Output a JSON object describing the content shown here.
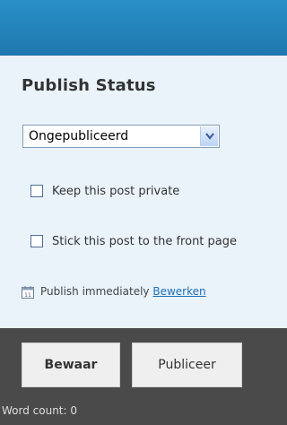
{
  "panel": {
    "title": "Publish Status",
    "status_select": {
      "selected": "Ongepubliceerd"
    },
    "checkbox_private": {
      "label": "Keep this post private",
      "checked": false
    },
    "checkbox_sticky": {
      "label": "Stick this post to the front page",
      "checked": false
    },
    "publish": {
      "text": "Publish immediately",
      "edit_link": "Bewerken"
    }
  },
  "footer": {
    "save_label": "Bewaar",
    "publish_label": "Publiceer",
    "word_count": "Word count: 0"
  },
  "colors": {
    "header": "#1f78ad",
    "panel_bg": "#eaf3fa",
    "footer_bg": "#4a4a4a",
    "link": "#1e6fb8"
  },
  "icons": [
    "chevron-down-icon",
    "calendar-icon"
  ]
}
